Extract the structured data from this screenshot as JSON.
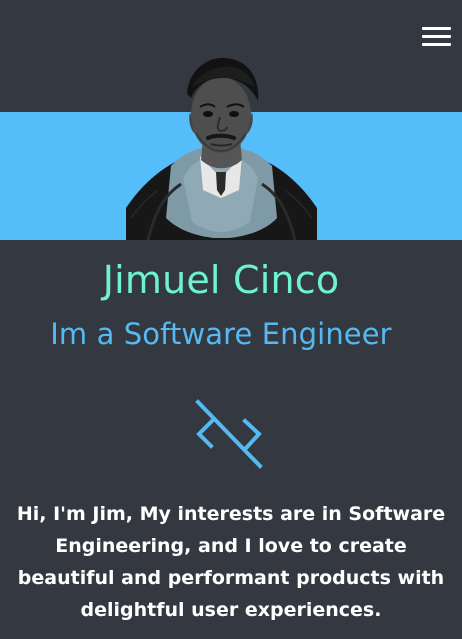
{
  "header": {
    "menu_icon": "hamburger-menu-icon"
  },
  "profile": {
    "name": "Jimuel Cinco",
    "role": "Im a Software Engineer",
    "photo": "profile-photo",
    "bio": "Hi, I'm Jim, My interests are in Software Engineering, and I love to create beautiful and performant products with delightful user experiences."
  },
  "colors": {
    "background": "#343841",
    "band": "#55bdf9",
    "name": "#6ef2d3",
    "role": "#54baf1",
    "text": "#ffffff"
  },
  "decorative": {
    "logo_icon": "code-brackets-icon"
  }
}
